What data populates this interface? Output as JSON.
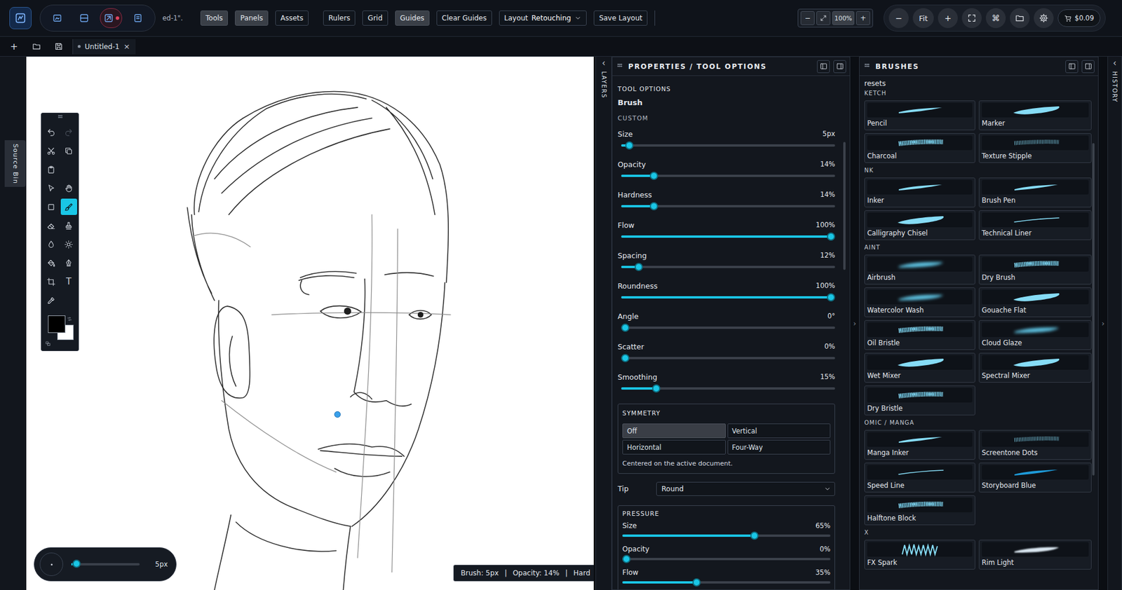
{
  "top_bar": {
    "modes": [
      {
        "selected": false,
        "recording": false
      },
      {
        "selected": false,
        "recording": false
      },
      {
        "selected": true,
        "recording": true
      },
      {
        "selected": false,
        "recording": false
      }
    ],
    "doc_title": "ed-1\".",
    "panel_toggles": [
      {
        "label": "Tools",
        "selected": true
      },
      {
        "label": "Panels",
        "selected": true
      },
      {
        "label": "Assets",
        "selected": false
      }
    ],
    "view_toggles": [
      {
        "label": "Rulers",
        "selected": false
      },
      {
        "label": "Grid",
        "selected": false
      },
      {
        "label": "Guides",
        "selected": true
      },
      {
        "label": "Clear Guides",
        "selected": false
      }
    ],
    "layout": {
      "label": "Layout",
      "value": "Retouching"
    },
    "save_layout": "Save Layout",
    "zoom": {
      "minus": "−",
      "value": "100%",
      "plus": "+"
    },
    "view": {
      "zoom_out": "−",
      "fit": "Fit",
      "zoom_in": "+",
      "command": "⌘"
    },
    "cost": "$0.09"
  },
  "document_tabs": {
    "new": "+",
    "tabs": [
      {
        "label": "Untitled-1",
        "close": "×",
        "selected": true,
        "modified": true
      }
    ]
  },
  "source_bin": "Source Bin",
  "toolbar": {
    "tools": [
      {
        "kind": "undo",
        "selected": false,
        "disabled": false
      },
      {
        "kind": "redo",
        "selected": false,
        "disabled": true
      },
      {
        "kind": "cut",
        "selected": false,
        "disabled": false
      },
      {
        "kind": "copy",
        "selected": false,
        "disabled": false
      },
      {
        "kind": "paste",
        "selected": false,
        "disabled": false
      },
      {
        "kind": "select",
        "selected": false,
        "disabled": false
      },
      {
        "kind": "hand",
        "selected": false,
        "disabled": false
      },
      {
        "kind": "rect",
        "selected": false,
        "disabled": false
      },
      {
        "kind": "brush",
        "selected": true,
        "disabled": false
      },
      {
        "kind": "eraser",
        "selected": false,
        "disabled": false
      },
      {
        "kind": "stamp",
        "selected": false,
        "disabled": false
      },
      {
        "kind": "blur",
        "selected": false,
        "disabled": false
      },
      {
        "kind": "dodge",
        "selected": false,
        "disabled": false
      },
      {
        "kind": "fill",
        "selected": false,
        "disabled": false
      },
      {
        "kind": "pen",
        "selected": false,
        "disabled": false
      },
      {
        "kind": "crop",
        "selected": false,
        "disabled": false
      },
      {
        "kind": "text",
        "glyph": "T",
        "selected": false,
        "disabled": false
      },
      {
        "kind": "eyedropper",
        "selected": false,
        "disabled": false
      }
    ],
    "colors": {
      "foreground": "#000000",
      "background": "#ffffff"
    }
  },
  "brush_size": {
    "level": 0.02,
    "reading": "5px"
  },
  "status_bar": {
    "items": [
      "Brush: 5px",
      "Opacity: 14%",
      "Hard"
    ],
    "separator": "|"
  },
  "layers_strip": {
    "arrow": "‹",
    "label": "LAYERS"
  },
  "properties": {
    "title": "PROPERTIES / TOOL OPTIONS",
    "section": "TOOL OPTIONS",
    "tool": "Brush",
    "preset": "CUSTOM",
    "sliders": [
      {
        "label": "Size",
        "value": "5px",
        "level": 0.02
      },
      {
        "label": "Opacity",
        "value": "14%",
        "level": 0.14
      },
      {
        "label": "Hardness",
        "value": "14%",
        "level": 0.14
      },
      {
        "label": "Flow",
        "value": "100%",
        "level": 1
      },
      {
        "label": "Spacing",
        "value": "12%",
        "level": 0.065
      },
      {
        "label": "Roundness",
        "value": "100%",
        "level": 1
      },
      {
        "label": "Angle",
        "value": "0°",
        "level": 0
      },
      {
        "label": "Scatter",
        "value": "0%",
        "level": 0
      },
      {
        "label": "Smoothing",
        "value": "15%",
        "level": 0.15
      }
    ],
    "symmetry": {
      "title": "SYMMETRY",
      "options": [
        {
          "label": "Off",
          "selected": true
        },
        {
          "label": "Vertical",
          "selected": false
        },
        {
          "label": "Horizontal",
          "selected": false
        },
        {
          "label": "Four-Way",
          "selected": false
        }
      ],
      "note": "Centered on the active document."
    },
    "tip": {
      "label": "Tip",
      "value": "Round"
    },
    "pressure": {
      "title": "PRESSURE",
      "sliders": [
        {
          "label": "Size",
          "value": "65%",
          "level": 0.64
        },
        {
          "label": "Opacity",
          "value": "0%",
          "level": 0
        },
        {
          "label": "Flow",
          "value": "35%",
          "level": 0.35
        }
      ]
    }
  },
  "divider_arrow": "›",
  "brushes": {
    "title": "BRUSHES",
    "presets_label": "resets",
    "sections": [
      {
        "title": "KETCH",
        "brushes": [
          {
            "label": "Pencil",
            "kind": "smooth"
          },
          {
            "label": "Marker",
            "kind": "thick"
          },
          {
            "label": "Charcoal",
            "kind": "textured"
          },
          {
            "label": "Texture Stipple",
            "kind": "stipple"
          }
        ]
      },
      {
        "title": "NK",
        "brushes": [
          {
            "label": "Inker",
            "kind": "smooth"
          },
          {
            "label": "Brush Pen",
            "kind": "smooth"
          },
          {
            "label": "Calligraphy Chisel",
            "kind": "thick"
          },
          {
            "label": "Technical Liner",
            "kind": "thin"
          }
        ]
      },
      {
        "title": "AINT",
        "brushes": [
          {
            "label": "Airbrush",
            "kind": "soft"
          },
          {
            "label": "Dry Brush",
            "kind": "textured"
          },
          {
            "label": "Watercolor Wash",
            "kind": "soft"
          },
          {
            "label": "Gouache Flat",
            "kind": "thick"
          },
          {
            "label": "Oil Bristle",
            "kind": "textured"
          },
          {
            "label": "Cloud Glaze",
            "kind": "soft"
          },
          {
            "label": "Wet Mixer",
            "kind": "thick"
          },
          {
            "label": "Spectral Mixer",
            "kind": "thick"
          },
          {
            "label": "Dry Bristle",
            "kind": "textured"
          }
        ]
      },
      {
        "title": "OMIC / MANGA",
        "brushes": [
          {
            "label": "Manga Inker",
            "kind": "smooth"
          },
          {
            "label": "Screentone Dots",
            "kind": "stipple"
          },
          {
            "label": "Speed Line",
            "kind": "thin"
          },
          {
            "label": "Storyboard Blue",
            "kind": "blue"
          },
          {
            "label": "Halftone Block",
            "kind": "textured"
          }
        ]
      },
      {
        "title": "X",
        "brushes": [
          {
            "label": "FX Spark",
            "kind": "spark"
          },
          {
            "label": "Rim Light",
            "kind": "glow"
          }
        ]
      }
    ]
  },
  "side_arrow": "›",
  "history_strip": {
    "arrow": "‹",
    "label": "HISTORY"
  }
}
